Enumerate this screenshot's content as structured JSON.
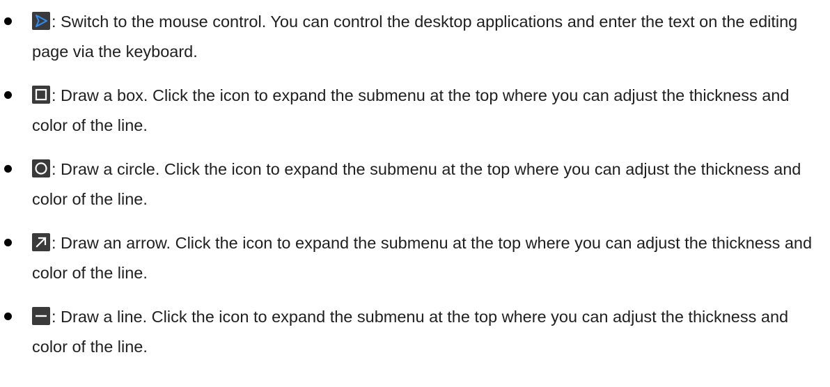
{
  "items": [
    {
      "icon": "mouse-pointer-icon",
      "text": ": Switch to the mouse control. You can control the desktop applications and enter the text on the editing page via the keyboard."
    },
    {
      "icon": "box-icon",
      "text": ": Draw a box. Click the icon to expand the submenu at the top where you can adjust the thickness and color of the line."
    },
    {
      "icon": "circle-icon",
      "text": ": Draw a circle. Click the icon to expand the submenu at the top where you can adjust the thickness and color of the line."
    },
    {
      "icon": "arrow-icon",
      "text": ": Draw an arrow. Click the icon to expand the submenu at the top where you can adjust the thickness and color of the line."
    },
    {
      "icon": "line-icon",
      "text": ": Draw a line. Click the icon to expand the submenu at the top where you can adjust the thickness and color of the line."
    }
  ],
  "colors": {
    "icon_background": "#3a3a3a",
    "icon_foreground": "#ffffff",
    "pointer_accent": "#2f8df5",
    "text": "#1f1f1f"
  }
}
